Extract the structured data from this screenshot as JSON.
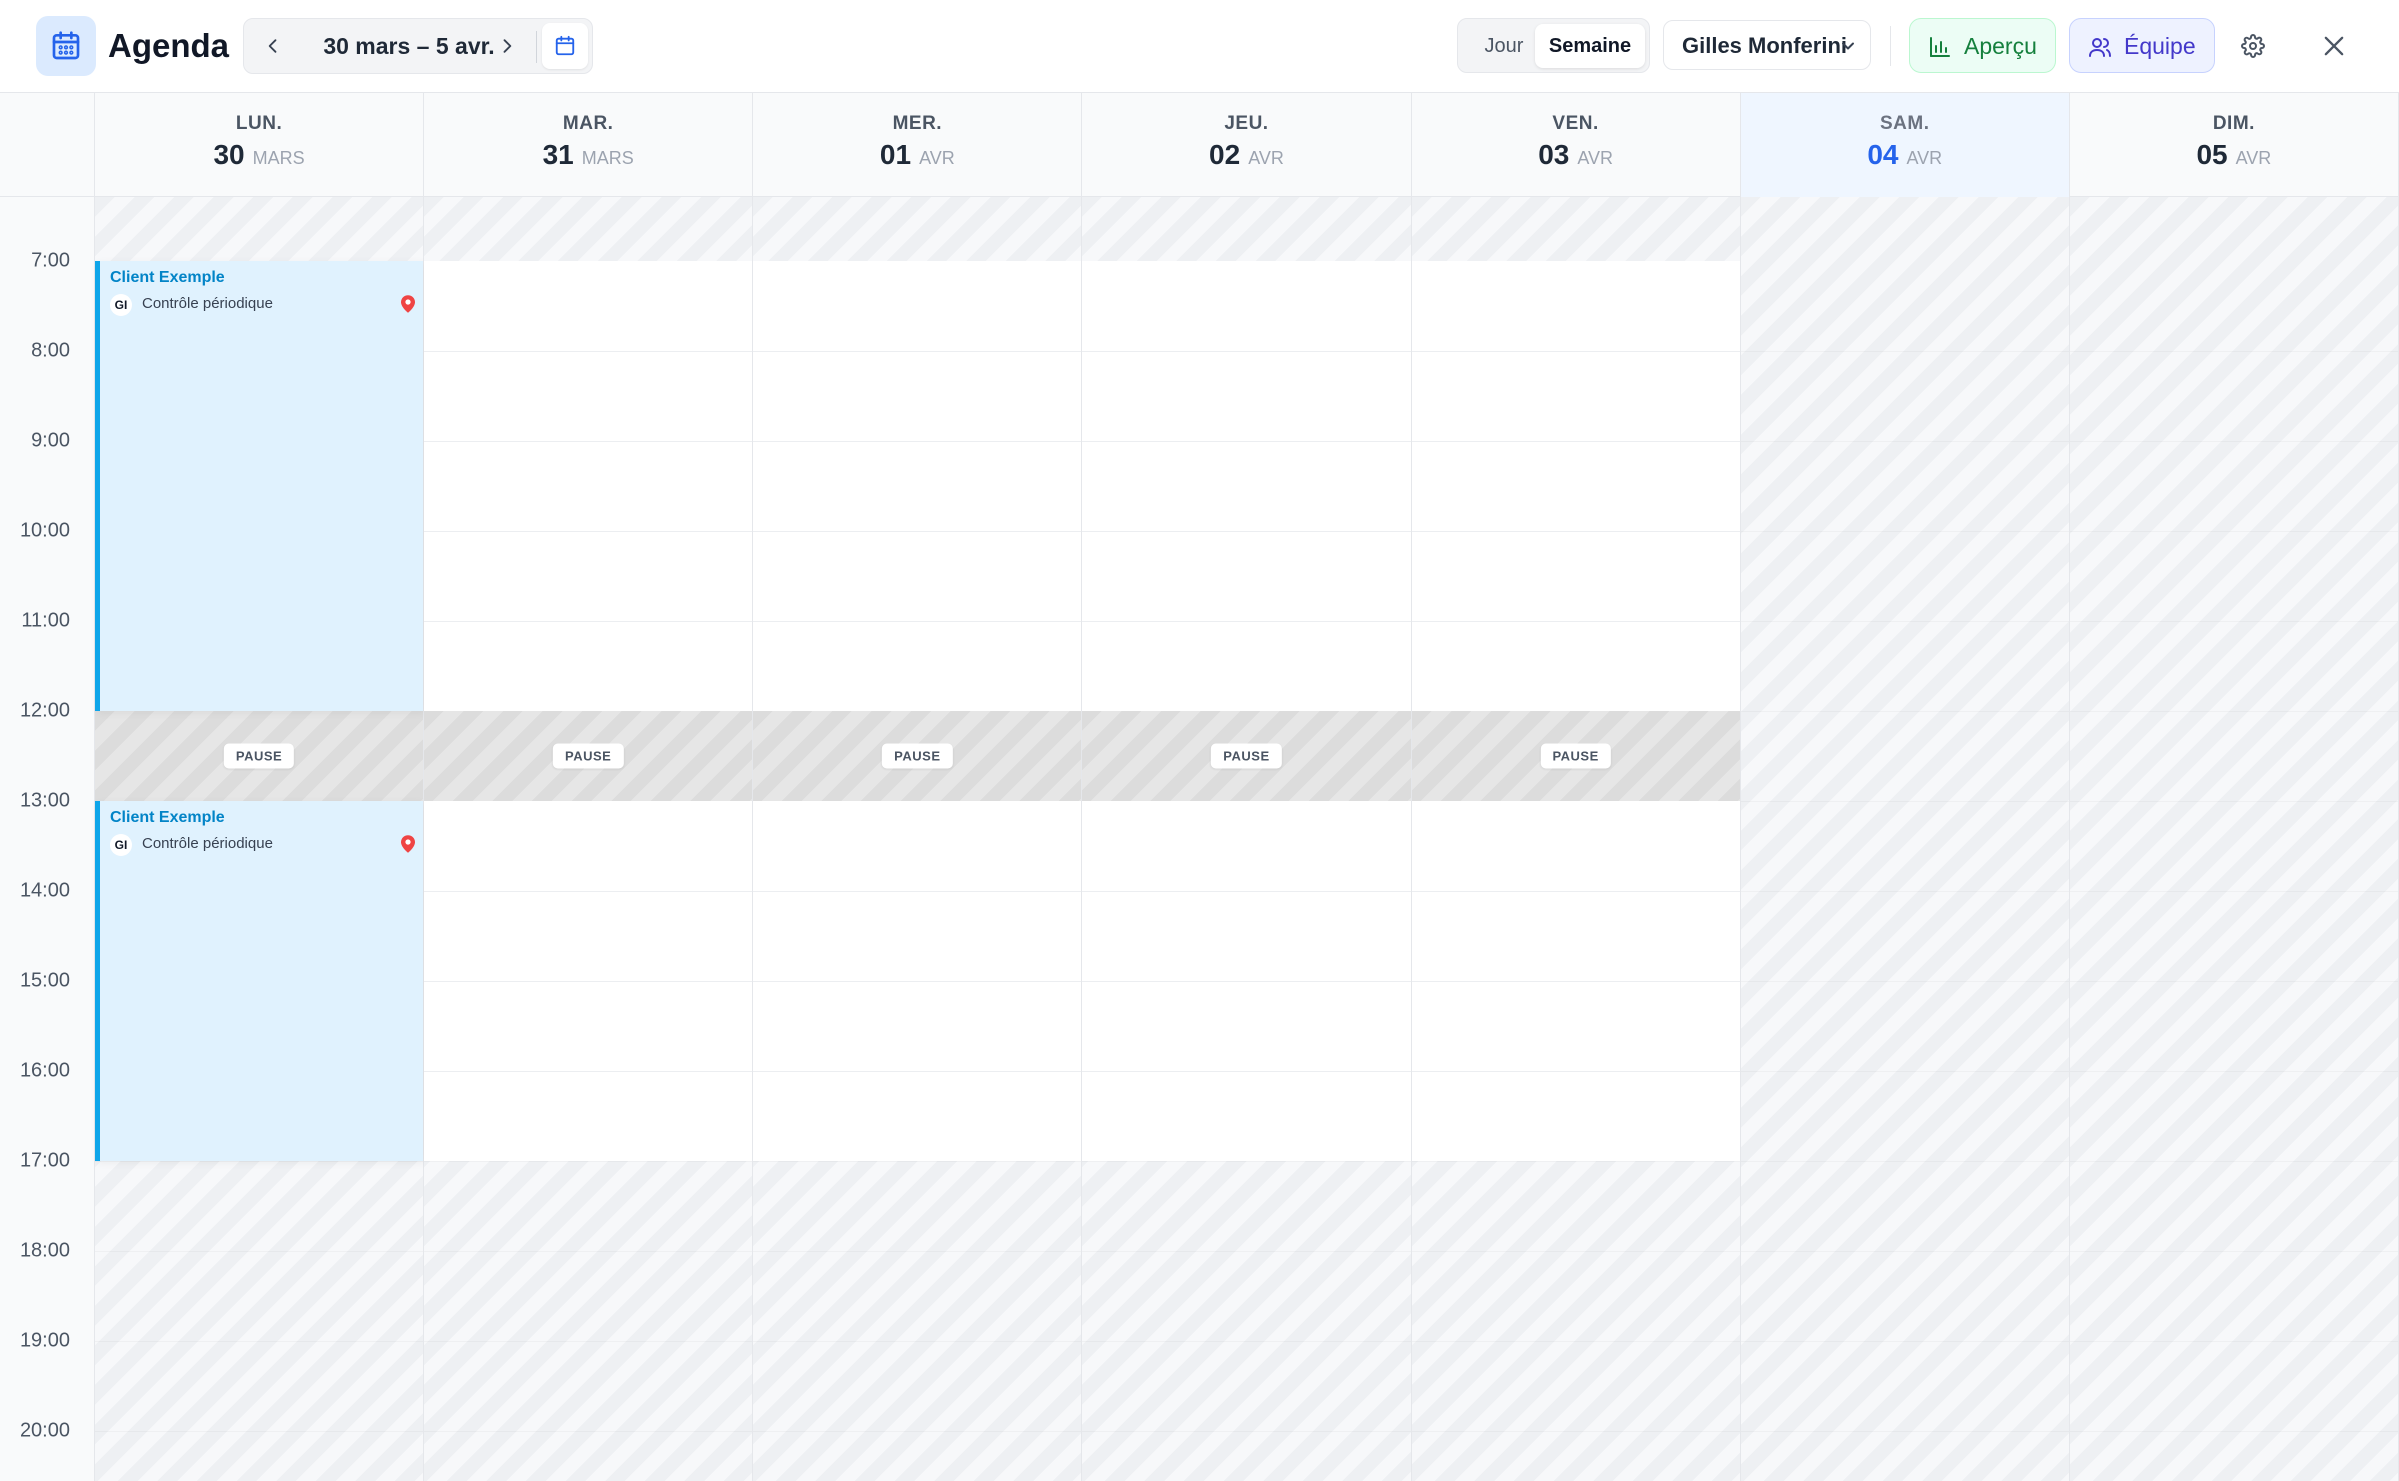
{
  "header": {
    "app_title": "Agenda",
    "app_icon": "calendar-icon",
    "date_range": "30 mars – 5 avr.",
    "prev_icon": "chevron-left-icon",
    "next_icon": "chevron-right-icon",
    "date_picker_icon": "calendar-icon",
    "view_day": "Jour",
    "view_week": "Semaine",
    "active_view": "Semaine",
    "user_select": "Gilles Monferini",
    "apercu_label": "Aperçu",
    "equipe_label": "Équipe",
    "settings_icon": "gear-icon",
    "close_icon": "close-icon"
  },
  "days": [
    {
      "dow": "LUN.",
      "num": "30",
      "month": "MARS",
      "weekend": false,
      "today": false
    },
    {
      "dow": "MAR.",
      "num": "31",
      "month": "MARS",
      "weekend": false,
      "today": false
    },
    {
      "dow": "MER.",
      "num": "01",
      "month": "AVR",
      "weekend": false,
      "today": false
    },
    {
      "dow": "JEU.",
      "num": "02",
      "month": "AVR",
      "weekend": false,
      "today": false
    },
    {
      "dow": "VEN.",
      "num": "03",
      "month": "AVR",
      "weekend": false,
      "today": false
    },
    {
      "dow": "SAM.",
      "num": "04",
      "month": "AVR",
      "weekend": true,
      "today": true
    },
    {
      "dow": "DIM.",
      "num": "05",
      "month": "AVR",
      "weekend": true,
      "today": false
    }
  ],
  "time_slots": [
    "7:00",
    "8:00",
    "9:00",
    "10:00",
    "11:00",
    "12:00",
    "13:00",
    "14:00",
    "15:00",
    "16:00",
    "17:00",
    "18:00",
    "19:00",
    "20:00"
  ],
  "pause_label": "PAUSE",
  "events": [
    {
      "title": "Client Exemple",
      "initials": "GI",
      "description": "Contrôle périodique",
      "day": "LUN.",
      "start": "7:00",
      "end": "12:00"
    },
    {
      "title": "Client Exemple",
      "initials": "GI",
      "description": "Contrôle périodique",
      "day": "LUN.",
      "start": "13:00",
      "end": "17:00"
    }
  ],
  "colors": {
    "accent": "#2563eb",
    "event_bg": "#e0f2fe",
    "event_border": "#0ea5e9",
    "apercu": "#15803d",
    "equipe": "#4338ca",
    "pin": "#ef4444"
  }
}
